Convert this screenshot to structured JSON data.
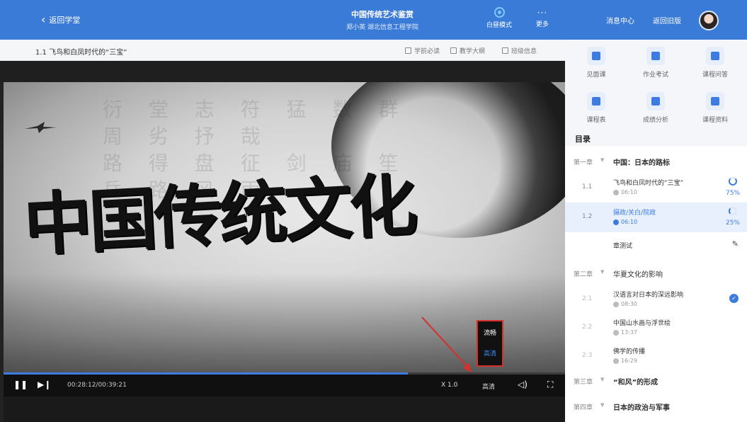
{
  "header": {
    "back_label": "返回学堂",
    "course_title": "中国传统艺术鉴赏",
    "course_sub": "郑小英  湖北信息工程学院",
    "day_mode": "白昼模式",
    "more_label": "更多",
    "more_dots": "···",
    "message_center": "消息中心",
    "old_version": "返回旧版"
  },
  "lesson": {
    "title": "1.1  飞鸟和白凤时代的“三宝”",
    "links": [
      "学前必读",
      "教学大纲",
      "班级信息"
    ]
  },
  "video": {
    "calligraphy": "中国传统文化",
    "time": "00:28:12/00:39:21",
    "progress": 0.72,
    "speed": "X 1.0",
    "quality": "高清",
    "quality_options": [
      "流畅",
      "高清"
    ],
    "selected_quality": "高清"
  },
  "sidebar": {
    "tools": [
      {
        "label": "见面课",
        "icon": "video-icon"
      },
      {
        "label": "作业考试",
        "icon": "pencil-doc-icon"
      },
      {
        "label": "课程问答",
        "icon": "chat-icon"
      },
      {
        "label": "课程表",
        "icon": "calendar-icon"
      },
      {
        "label": "成绩分析",
        "icon": "grade-icon"
      },
      {
        "label": "课程资料",
        "icon": "folder-icon"
      }
    ],
    "toc_title": "目录",
    "chapters": [
      {
        "no": "第一章",
        "name": "中国：日本的路标"
      },
      {
        "no": "第二章",
        "name": "华夏文化的影响"
      },
      {
        "no": "第三章",
        "name": "“和风”的形成"
      },
      {
        "no": "第四章",
        "name": "日本的政治与军事"
      }
    ],
    "sections": [
      {
        "no": "1.1",
        "name": "飞鸟和白凤时代的“三宝”",
        "duration": "06:10",
        "progress": "75%"
      },
      {
        "no": "1.2",
        "name": "摄政/关白/院政",
        "duration": "06:10",
        "progress": "25%"
      },
      {
        "no": "",
        "name": "章测试",
        "duration": "",
        "progress": ""
      },
      {
        "no": "2.1",
        "name": "汉语言对日本的深远影响",
        "duration": "08:30",
        "progress": ""
      },
      {
        "no": "2.2",
        "name": "中国山水画与浮世绘",
        "duration": "13:37",
        "progress": ""
      },
      {
        "no": "2.3",
        "name": "佛学的传播",
        "duration": "16:29",
        "progress": ""
      }
    ]
  },
  "colors": {
    "topbar": "#3b7bd8",
    "accent": "#3d7be0",
    "highlight": "#d6302b"
  }
}
